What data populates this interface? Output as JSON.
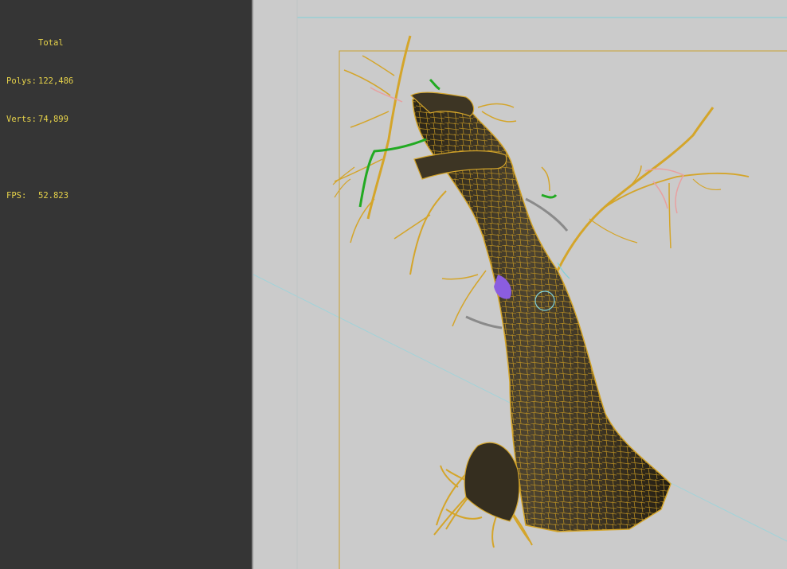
{
  "stats": {
    "header": "Total",
    "polys_label": "Polys:",
    "polys_value": "122,486",
    "verts_label": "Verts:",
    "verts_value": "74,899",
    "fps_label": "FPS:",
    "fps_value": "52.823"
  },
  "colors": {
    "panel_bg": "#353535",
    "viewport_bg": "#cbcbcb",
    "stats_text": "#e8d44a",
    "wire": "#d4a52a",
    "safe_frame": "#c9a030",
    "grid_line": "#7fd0d8"
  }
}
